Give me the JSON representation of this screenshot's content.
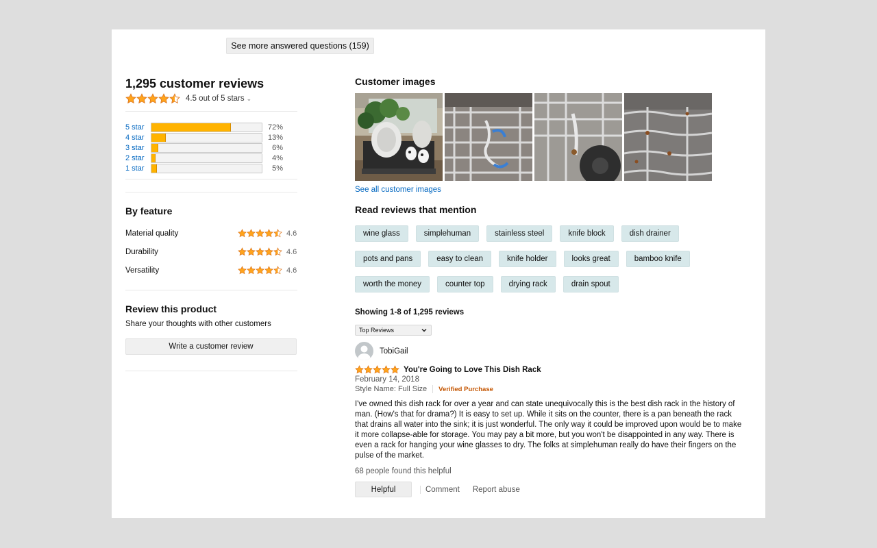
{
  "qa": {
    "see_more_label": "See more answered questions (159)"
  },
  "summary": {
    "total_reviews": "1,295 customer reviews",
    "average_text": "4.5 out of 5 stars",
    "average_rating": 4.5,
    "histogram": [
      {
        "label": "5 star",
        "percent_text": "72%",
        "percent": 72
      },
      {
        "label": "4 star",
        "percent_text": "13%",
        "percent": 13
      },
      {
        "label": "3 star",
        "percent_text": "6%",
        "percent": 6
      },
      {
        "label": "2 star",
        "percent_text": "4%",
        "percent": 4
      },
      {
        "label": "1 star",
        "percent_text": "5%",
        "percent": 5
      }
    ]
  },
  "by_feature": {
    "title": "By feature",
    "items": [
      {
        "name": "Material quality",
        "score": "4.6",
        "rating": 4.6
      },
      {
        "name": "Durability",
        "score": "4.6",
        "rating": 4.6
      },
      {
        "name": "Versatility",
        "score": "4.6",
        "rating": 4.6
      }
    ]
  },
  "review_product": {
    "title": "Review this product",
    "subtitle": "Share your thoughts with other customers",
    "button_label": "Write a customer review"
  },
  "customer_images": {
    "title": "Customer images",
    "see_all_label": "See all customer images"
  },
  "mentions": {
    "title": "Read reviews that mention",
    "tags": [
      "wine glass",
      "simplehuman",
      "stainless steel",
      "knife block",
      "dish drainer",
      "pots and pans",
      "easy to clean",
      "knife holder",
      "looks great",
      "bamboo knife",
      "worth the money",
      "counter top",
      "drying rack",
      "drain spout"
    ]
  },
  "reviews": {
    "showing_text": "Showing 1-8 of 1,295 reviews",
    "sort_selected": "Top Reviews",
    "items": [
      {
        "author": "TobiGail",
        "rating": 5,
        "title": "You're Going to Love This Dish Rack",
        "date": "February 14, 2018",
        "style": "Style Name: Full Size",
        "verified": "Verified Purchase",
        "body": "I've owned this dish rack for over a year and can state unequivocally this is the best dish rack in the history of man. (How's that for drama?) It is easy to set up. While it sits on the counter, there is a pan beneath the rack that drains all water into the sink; it is just wonderful. The only way it could be improved upon would be to make it more collapse-able for storage. You may pay a bit more, but you won't be disappointed in any way. There is even a rack for hanging your wine glasses to dry. The folks at simplehuman really do have their fingers on the pulse of the market.",
        "helpful_count": "68 people found this helpful",
        "helpful_label": "Helpful",
        "comment_label": "Comment",
        "report_label": "Report abuse"
      }
    ]
  },
  "colors": {
    "star": "#ffa41c",
    "link": "#0066c0",
    "bar": "#ffb300",
    "tag": "#d7e8ea",
    "verified": "#c45500"
  }
}
